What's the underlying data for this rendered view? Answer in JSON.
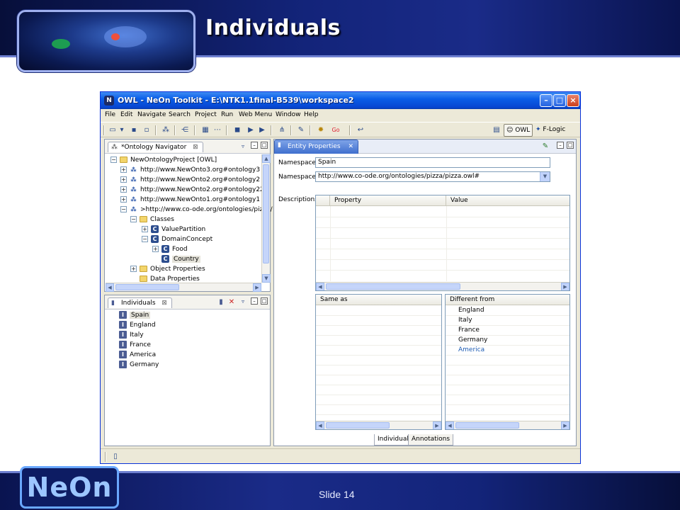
{
  "slide": {
    "title": "Individuals",
    "number": "Slide 14",
    "logo_text": "NeOn"
  },
  "window": {
    "title": "OWL - NeOn Toolkit - E:\\NTK1.1final-B539\\workspace2",
    "menu": [
      "File",
      "Edit",
      "Navigate",
      "Search",
      "Project",
      "Run",
      "Web Menu",
      "Window",
      "Help"
    ],
    "perspectives": [
      "OWL",
      "F-Logic"
    ]
  },
  "navigator": {
    "tab_label": "*Ontology Navigator",
    "items": [
      {
        "label": "NewOntologyProject [OWL]"
      },
      {
        "label": "http://www.NewOnto3.org#ontology3"
      },
      {
        "label": "http://www.NewOnto2.org#ontology2"
      },
      {
        "label": "http://www.NewOnto2.org#ontology22"
      },
      {
        "label": "http://www.NewOnto1.org#ontology1"
      },
      {
        "label": ">http://www.co-ode.org/ontologies/pizza/"
      },
      {
        "label": "Classes"
      },
      {
        "label": "ValuePartition"
      },
      {
        "label": "DomainConcept"
      },
      {
        "label": "Food"
      },
      {
        "label": "Country"
      },
      {
        "label": "Object Properties"
      },
      {
        "label": "Data Properties"
      }
    ]
  },
  "individuals": {
    "tab_label": "Individuals",
    "items": [
      "Spain",
      "England",
      "Italy",
      "France",
      "America",
      "Germany"
    ]
  },
  "entity": {
    "tab_label": "Entity Properties",
    "namespace_label": "Namespace",
    "name_value": "Spain",
    "namespace_value": "http://www.co-ode.org/ontologies/pizza/pizza.owl#",
    "descriptions_label": "Descriptions",
    "columns": [
      "Property",
      "Value"
    ],
    "same_as_label": "Same as",
    "different_from_label": "Different from",
    "different_from": [
      "England",
      "Italy",
      "France",
      "Germany",
      "America"
    ],
    "bottom_tabs": [
      "Individuals",
      "Annotations"
    ]
  },
  "colors": {
    "link_blue": "#1e5cb3"
  }
}
